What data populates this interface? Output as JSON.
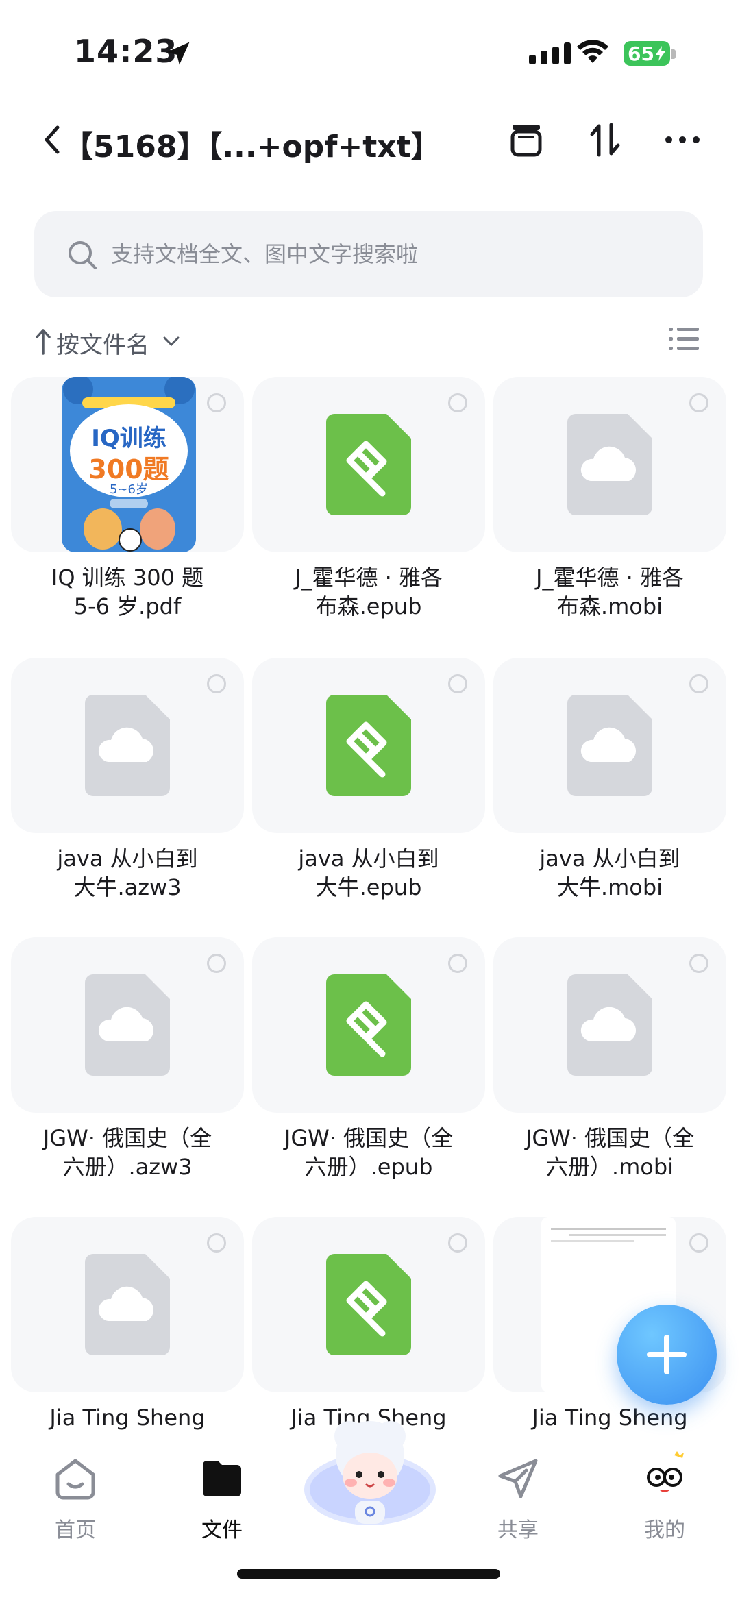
{
  "status_bar": {
    "time": "14:23",
    "battery": "65"
  },
  "header": {
    "title": "【5168】【...+opf+txt】"
  },
  "search": {
    "placeholder": "支持文档全文、图中文字搜索啦"
  },
  "sort": {
    "label": "按文件名"
  },
  "cover": {
    "title": "IQ训练",
    "number": "300题",
    "age": "5~6岁"
  },
  "files": [
    {
      "line1": "IQ 训练 300 题",
      "line2": "5-6 岁.pdf",
      "type": "pdf"
    },
    {
      "line1": "J_霍华德 · 雅各",
      "line2": "布森.epub",
      "type": "epub"
    },
    {
      "line1": "J_霍华德 · 雅各",
      "line2": "布森.mobi",
      "type": "cloud"
    },
    {
      "line1": "java 从小白到",
      "line2": "大牛.azw3",
      "type": "cloud"
    },
    {
      "line1": "java 从小白到",
      "line2": "大牛.epub",
      "type": "epub"
    },
    {
      "line1": "java 从小白到",
      "line2": "大牛.mobi",
      "type": "cloud"
    },
    {
      "line1": "JGW· 俄国史（全",
      "line2": "六册）.azw3",
      "type": "cloud"
    },
    {
      "line1": "JGW· 俄国史（全",
      "line2": "六册）.epub",
      "type": "epub"
    },
    {
      "line1": "JGW· 俄国史（全",
      "line2": "六册）.mobi",
      "type": "cloud"
    },
    {
      "line1": "Jia Ting Sheng",
      "line2": "",
      "type": "cloud"
    },
    {
      "line1": "Jia Ting Sheng",
      "line2": "",
      "type": "epub"
    },
    {
      "line1": "Jia Ting Sheng",
      "line2": "",
      "type": "txt"
    }
  ],
  "tabs": [
    {
      "label": "首页",
      "icon": "home-icon"
    },
    {
      "label": "文件",
      "icon": "folder-icon",
      "active": true
    },
    {
      "label": "",
      "icon": "assistant-mascot-icon"
    },
    {
      "label": "共享",
      "icon": "share-plane-icon"
    },
    {
      "label": "我的",
      "icon": "profile-mascot-icon"
    }
  ],
  "colors": {
    "epub_green": "#6cc04a",
    "cloud_gray": "#d5d7dc",
    "accent_blue": "#3a8ff0"
  }
}
